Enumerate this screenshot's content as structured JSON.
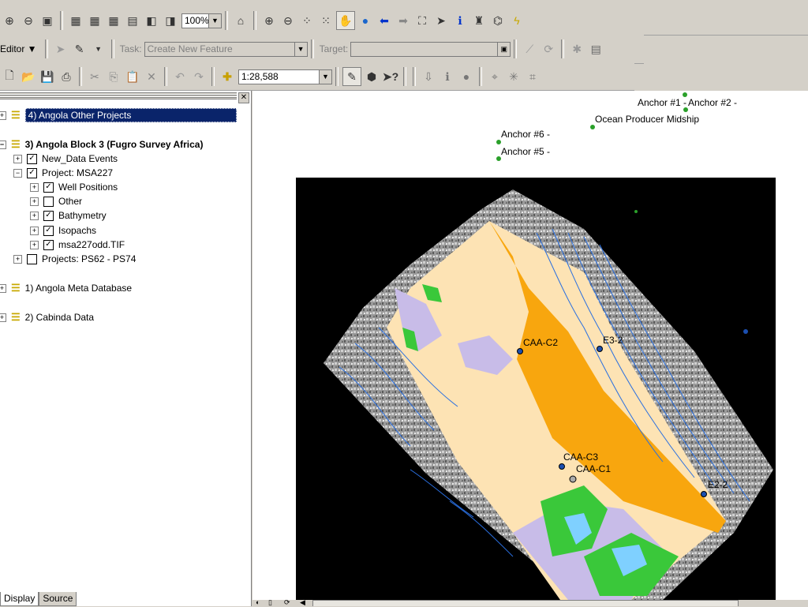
{
  "toolbar1": {
    "zoom_percent": "100%"
  },
  "toolbar2": {
    "editor_label": "Editor ▼",
    "task_label": "Task:",
    "task_value": "Create New Feature",
    "target_label": "Target:",
    "target_value": ""
  },
  "toolbar3": {
    "scale_value": "1:28,588"
  },
  "toc": {
    "items": [
      {
        "label": "4) Angola Other Projects"
      },
      {
        "label": "3) Angola Block 3 (Fugro  Survey Africa)"
      },
      {
        "label": "New_Data Events"
      },
      {
        "label": "Project: MSA227"
      },
      {
        "label": "Well Positions"
      },
      {
        "label": "Other"
      },
      {
        "label": "Bathymetry"
      },
      {
        "label": "Isopachs"
      },
      {
        "label": "msa227odd.TIF"
      },
      {
        "label": "Projects: PS62 - PS74"
      },
      {
        "label": "1) Angola Meta Database"
      },
      {
        "label": "2) Cabinda Data"
      }
    ],
    "tabs": [
      "Display",
      "Source"
    ]
  },
  "map": {
    "labels": [
      "Anchor #1 -",
      "Anchor #2 -",
      "Ocean Producer Midship",
      "Anchor #6 -",
      "Anchor #5 -",
      "CAA-C2",
      "E3-2",
      "CAA-C3",
      "CAA-C1",
      "E2-2"
    ]
  }
}
